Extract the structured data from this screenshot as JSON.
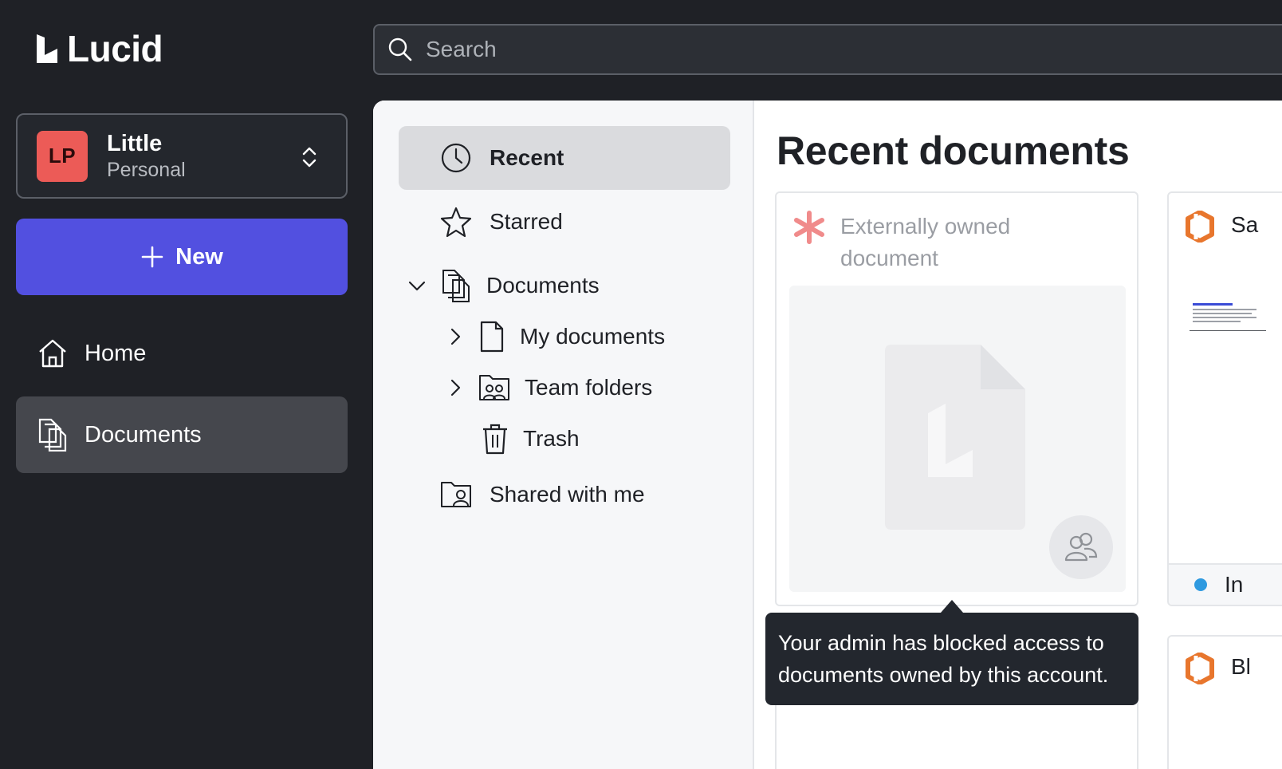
{
  "app": {
    "name": "Lucid"
  },
  "account": {
    "initials": "LP",
    "name": "Little",
    "type": "Personal"
  },
  "sidebar": {
    "new_label": "New",
    "items": [
      {
        "label": "Home"
      },
      {
        "label": "Documents"
      }
    ]
  },
  "search": {
    "placeholder": "Search"
  },
  "tree": {
    "recent": "Recent",
    "starred": "Starred",
    "documents": "Documents",
    "my_documents": "My documents",
    "team_folders": "Team folders",
    "trash": "Trash",
    "shared": "Shared with me"
  },
  "main": {
    "title": "Recent documents",
    "cards": [
      {
        "title": "Externally owned document"
      },
      {
        "title": "Sa",
        "status": "In"
      },
      {
        "title": "Bl"
      }
    ]
  },
  "tooltip": {
    "text": "Your admin has blocked access to documents owned by this account."
  },
  "colors": {
    "accent": "#5250e0",
    "avatar": "#ec5b57",
    "status_dot": "#2f9ae0",
    "lucid_orange": "#e8762d"
  }
}
